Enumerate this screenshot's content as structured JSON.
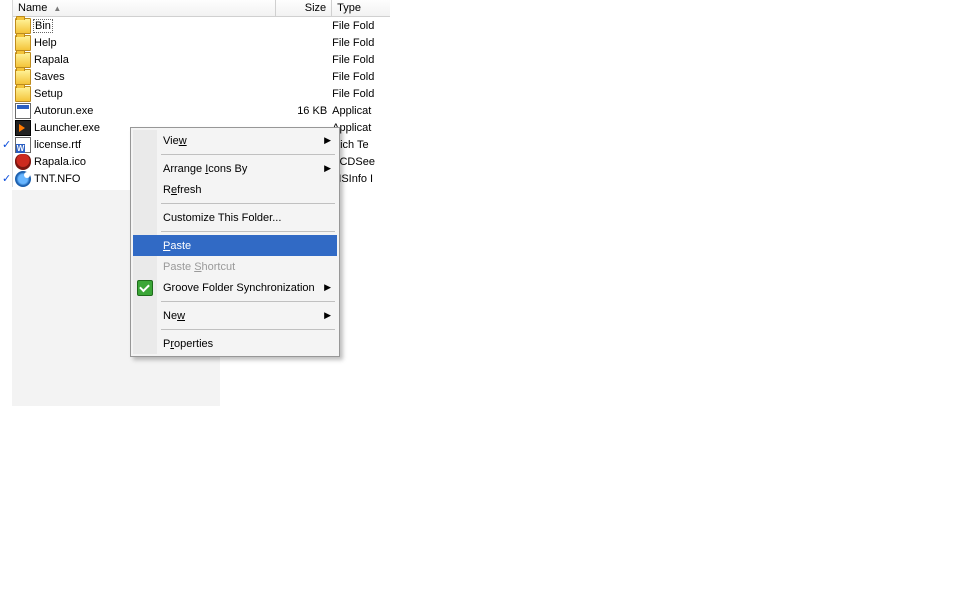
{
  "columns": {
    "name": "Name",
    "size": "Size",
    "type": "Type"
  },
  "files": [
    {
      "icon": "folder",
      "name": "Bin",
      "size": "",
      "type": "File Fold",
      "selected": true
    },
    {
      "icon": "folder",
      "name": "Help",
      "size": "",
      "type": "File Fold"
    },
    {
      "icon": "folder",
      "name": "Rapala",
      "size": "",
      "type": "File Fold"
    },
    {
      "icon": "folder",
      "name": "Saves",
      "size": "",
      "type": "File Fold"
    },
    {
      "icon": "folder",
      "name": "Setup",
      "size": "",
      "type": "File Fold"
    },
    {
      "icon": "exe",
      "name": "Autorun.exe",
      "size": "16 KB",
      "type": "Applicat"
    },
    {
      "icon": "launcher",
      "name": "Launcher.exe",
      "size": "",
      "type": "Applicat"
    },
    {
      "icon": "rtf",
      "name": "license.rtf",
      "size": "",
      "type": "Rich Te",
      "gutter_check": true
    },
    {
      "icon": "ico",
      "name": "Rapala.ico",
      "size": "",
      "type": "ACDSee"
    },
    {
      "icon": "nfo",
      "name": "TNT.NFO",
      "size": "",
      "type": "MSInfo I",
      "gutter_check": true
    }
  ],
  "context_menu": {
    "items": [
      {
        "kind": "item",
        "label": "View",
        "u": 3,
        "submenu": true
      },
      {
        "kind": "sep"
      },
      {
        "kind": "item",
        "label": "Arrange Icons By",
        "u": 8,
        "submenu": true
      },
      {
        "kind": "item",
        "label": "Refresh",
        "u": 1
      },
      {
        "kind": "sep"
      },
      {
        "kind": "item",
        "label": "Customize This Folder...",
        "u": -1
      },
      {
        "kind": "sep"
      },
      {
        "kind": "item",
        "label": "Paste",
        "u": 0,
        "highlight": true
      },
      {
        "kind": "item",
        "label": "Paste Shortcut",
        "u": 6,
        "disabled": true
      },
      {
        "kind": "item",
        "label": "Groove Folder Synchronization",
        "u": -1,
        "submenu": true,
        "icon": "groove"
      },
      {
        "kind": "sep"
      },
      {
        "kind": "item",
        "label": "New",
        "u": 2,
        "submenu": true
      },
      {
        "kind": "sep"
      },
      {
        "kind": "item",
        "label": "Properties",
        "u": 1
      }
    ]
  }
}
